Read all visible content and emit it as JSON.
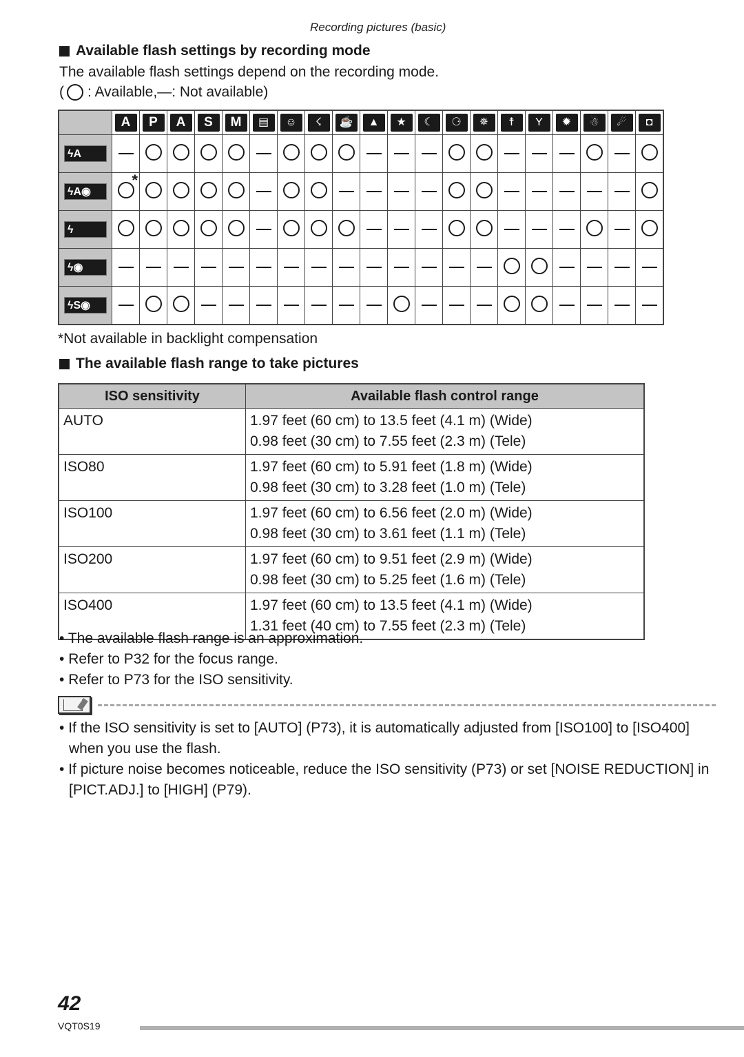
{
  "running_head": "Recording pictures (basic)",
  "section1": {
    "title": "Available flash settings by recording mode",
    "intro": "The available flash settings depend on the recording mode.",
    "legend_open": "(",
    "legend_available": ": Available, ",
    "legend_dash": "—",
    "legend_not_available": ": Not available)"
  },
  "flash_grid": {
    "modes": [
      {
        "label": "A",
        "icon": "intelligent-auto-icon"
      },
      {
        "label": "P",
        "icon": "program-ae-icon"
      },
      {
        "label": "A",
        "icon": "aperture-priority-icon"
      },
      {
        "label": "S",
        "icon": "shutter-priority-icon"
      },
      {
        "label": "M",
        "icon": "manual-exposure-icon"
      },
      {
        "label": "▤",
        "icon": "motion-picture-icon"
      },
      {
        "label": "☺",
        "icon": "portrait-icon"
      },
      {
        "label": "☇",
        "icon": "sports-icon"
      },
      {
        "label": "☕",
        "icon": "food-icon"
      },
      {
        "label": "▲",
        "icon": "scenery-icon"
      },
      {
        "label": "★",
        "icon": "night-portrait-icon"
      },
      {
        "label": "☾",
        "icon": "night-scenery-icon"
      },
      {
        "label": "⚆",
        "icon": "baby-icon"
      },
      {
        "label": "✵",
        "icon": "soft-skin-icon"
      },
      {
        "label": "☨",
        "icon": "candle-light-icon"
      },
      {
        "label": "Y",
        "icon": "party-icon"
      },
      {
        "label": "✹",
        "icon": "fireworks-icon"
      },
      {
        "label": "☃",
        "icon": "snow-icon"
      },
      {
        "label": "☄",
        "icon": "starry-sky-icon"
      },
      {
        "label": "◘",
        "icon": "self-portrait-icon"
      }
    ],
    "rows": [
      {
        "label": "ϟA",
        "name": "auto",
        "cells": [
          0,
          1,
          1,
          1,
          1,
          0,
          1,
          1,
          1,
          0,
          0,
          0,
          1,
          1,
          0,
          0,
          0,
          1,
          0,
          1
        ]
      },
      {
        "label": "ϟA◉",
        "name": "auto-red-eye",
        "cells": [
          1,
          1,
          1,
          1,
          1,
          0,
          1,
          1,
          0,
          0,
          0,
          0,
          1,
          1,
          0,
          0,
          0,
          0,
          0,
          1
        ],
        "asterisk_col": 0
      },
      {
        "label": "ϟ",
        "name": "forced-on",
        "cells": [
          1,
          1,
          1,
          1,
          1,
          0,
          1,
          1,
          1,
          0,
          0,
          0,
          1,
          1,
          0,
          0,
          0,
          1,
          0,
          1
        ]
      },
      {
        "label": "ϟ◉",
        "name": "forced-on-red-eye",
        "cells": [
          0,
          0,
          0,
          0,
          0,
          0,
          0,
          0,
          0,
          0,
          0,
          0,
          0,
          0,
          1,
          1,
          0,
          0,
          0,
          0
        ]
      },
      {
        "label": "ϟS◉",
        "name": "slow-sync-red-eye",
        "cells": [
          0,
          1,
          1,
          0,
          0,
          0,
          0,
          0,
          0,
          0,
          1,
          0,
          0,
          0,
          1,
          1,
          0,
          0,
          0,
          0
        ]
      }
    ],
    "asterisk": "*"
  },
  "footnote": "*Not available in backlight compensation",
  "section2": {
    "title": "The available flash range to take pictures",
    "headers": [
      "ISO sensitivity",
      "Available flash control range"
    ],
    "rows": [
      {
        "iso": "AUTO",
        "wide": "1.97 feet (60 cm) to 13.5 feet (4.1 m) (Wide)",
        "tele": "0.98 feet (30 cm) to 7.55 feet (2.3 m) (Tele)"
      },
      {
        "iso": "ISO80",
        "wide": "1.97 feet (60 cm) to 5.91 feet (1.8 m) (Wide)",
        "tele": "0.98 feet (30 cm) to 3.28 feet (1.0 m) (Tele)"
      },
      {
        "iso": "ISO100",
        "wide": "1.97 feet (60 cm) to 6.56 feet (2.0 m) (Wide)",
        "tele": "0.98 feet (30 cm) to 3.61 feet (1.1 m) (Tele)"
      },
      {
        "iso": "ISO200",
        "wide": "1.97 feet (60 cm) to 9.51 feet (2.9 m) (Wide)",
        "tele": "0.98 feet (30 cm) to 5.25 feet (1.6 m) (Tele)"
      },
      {
        "iso": "ISO400",
        "wide": "1.97 feet (60 cm) to 13.5 feet (4.1 m) (Wide)",
        "tele": "1.31 feet (40 cm) to 7.55 feet (2.3 m) (Tele)"
      }
    ],
    "notes": [
      "The available flash range is an approximation.",
      "Refer to P32 for the focus range.",
      "Refer to P73 for the ISO sensitivity."
    ]
  },
  "memo": {
    "icon": "memo-book-icon",
    "tips": [
      "If the ISO sensitivity is set to [AUTO] (P73), it is automatically adjusted from [ISO100] to [ISO400] when you use the flash.",
      "If picture noise becomes noticeable, reduce the ISO sensitivity (P73) or set [NOISE REDUCTION] in [PICT.ADJ.] to [HIGH] (P79)."
    ]
  },
  "footer": {
    "page_number": "42",
    "doc_code": "VQT0S19"
  }
}
